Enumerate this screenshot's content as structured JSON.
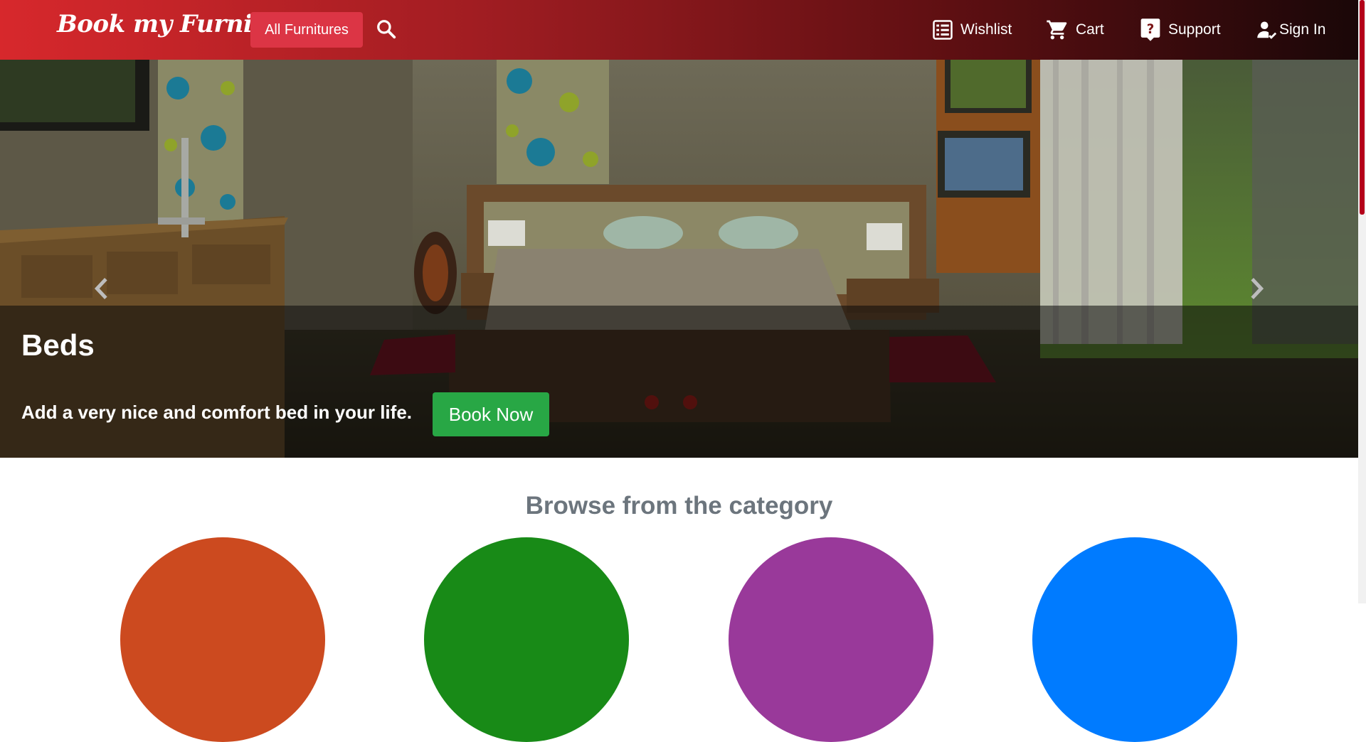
{
  "navbar": {
    "brand": "Book my Furniture",
    "all_furnitures": "All Furnitures",
    "wishlist": "Wishlist",
    "cart": "Cart",
    "support": "Support",
    "sign_in": "Sign In"
  },
  "hero": {
    "title": "Beds",
    "text": "Add a very nice and comfort bed in your life.",
    "button": "Book Now"
  },
  "browse": {
    "title": "Browse from the category",
    "circles": [
      "#cc4a1f",
      "#188a17",
      "#99399a",
      "#007bff"
    ]
  }
}
